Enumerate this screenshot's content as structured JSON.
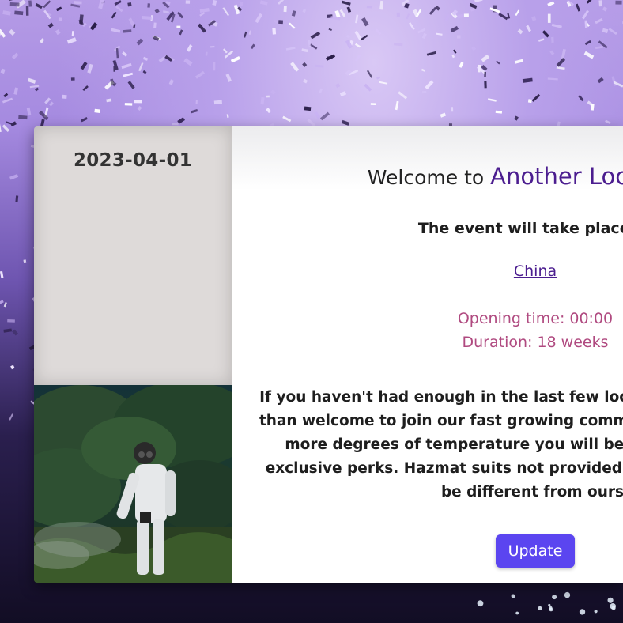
{
  "event": {
    "date": "2023-04-01",
    "welcome_prefix": "Welcome to ",
    "name": "Another Lockdown",
    "place_line": "The event will take place at",
    "location": "China",
    "opening_time": "Opening time: 00:00",
    "duration": "Duration: 18 weeks",
    "description_lines": [
      "If you haven't had enough in the last few lockdowns, you are more",
      "than welcome to join our fast growing community. The higher your",
      "more degrees of temperature you will be able to enjoy some",
      "exclusive perks. Hazmat suits not provided. Your experience may",
      "be different from ours."
    ],
    "update_label": "Update"
  },
  "colors": {
    "accent": "#5b45f0",
    "event_name": "#4b1d8f",
    "times": "#b04a80"
  }
}
